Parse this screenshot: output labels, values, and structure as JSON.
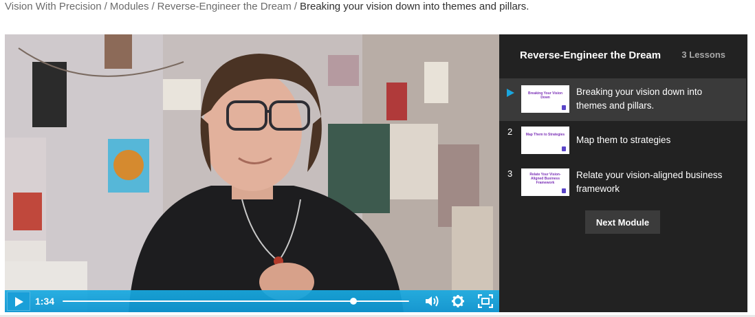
{
  "breadcrumb": {
    "items": [
      "Vision With Precision",
      "Modules",
      "Reverse-Engineer the Dream"
    ],
    "separator": "/",
    "current": "Breaking your vision down into themes and pillars."
  },
  "player": {
    "time": "1:34",
    "progress": 0.84,
    "accent": "#1aa6de"
  },
  "sidebar": {
    "title": "Reverse-Engineer the Dream",
    "count": "3 Lessons",
    "lessons": [
      {
        "num": "",
        "thumb": "Breaking Your Vision Down",
        "title": "Breaking your vision down into themes and pillars.",
        "active": true
      },
      {
        "num": "2",
        "thumb": "Map Them to Strategies",
        "title": "Map them to strategies",
        "active": false
      },
      {
        "num": "3",
        "thumb": "Relate Your Vision-Aligned Business Framework",
        "title": "Relate your vision-aligned business framework",
        "active": false
      }
    ],
    "next_label": "Next Module"
  }
}
